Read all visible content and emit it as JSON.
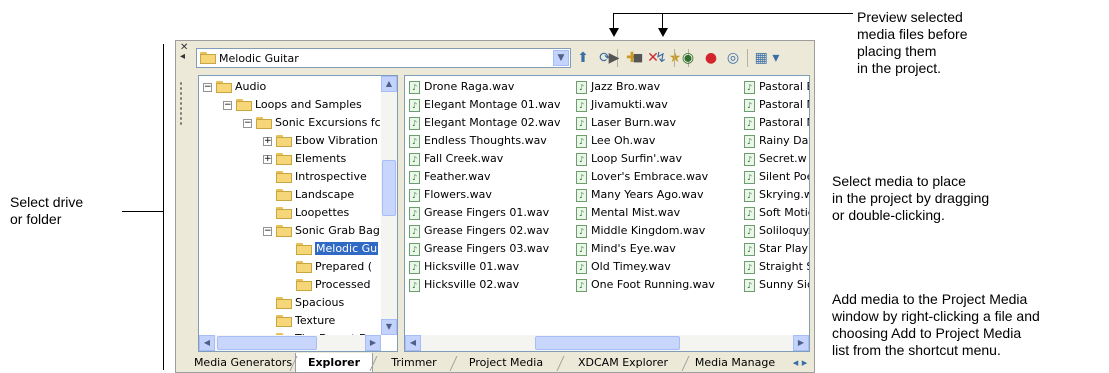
{
  "callouts": {
    "preview_lines": [
      "Preview selected",
      "media files before",
      "placing them",
      "in the project."
    ],
    "select_drive": [
      "Select drive",
      "or folder"
    ],
    "select_media": [
      "Select media to place",
      "in the project by dragging",
      "or double-clicking."
    ],
    "add_media": [
      "Add media to the Project Media",
      "window by right-clicking a file and",
      "choosing Add to Project Media",
      "list from the shortcut menu."
    ]
  },
  "toolbar": {
    "path": "Melodic Guitar",
    "icons": [
      "up-folder-icon",
      "refresh-icon",
      "new-folder-icon",
      "delete-icon",
      "favorites-icon",
      "play-icon",
      "stop-icon",
      "auto-preview-icon",
      "start-icon",
      "web-icon",
      "get-media-icon",
      "views-icon"
    ]
  },
  "tree": [
    {
      "label": "Audio",
      "indent": 0,
      "toggle": "−"
    },
    {
      "label": "Loops and Samples",
      "indent": 1,
      "toggle": "−"
    },
    {
      "label": "Sonic Excursions fc",
      "indent": 2,
      "toggle": "−"
    },
    {
      "label": "Ebow Vibration",
      "indent": 3,
      "toggle": "+"
    },
    {
      "label": "Elements",
      "indent": 3,
      "toggle": "+"
    },
    {
      "label": "Introspective",
      "indent": 3,
      "toggle": ""
    },
    {
      "label": "Landscape",
      "indent": 3,
      "toggle": ""
    },
    {
      "label": "Loopettes",
      "indent": 3,
      "toggle": ""
    },
    {
      "label": "Sonic Grab Bag",
      "indent": 3,
      "toggle": "−"
    },
    {
      "label": "Melodic Gu",
      "indent": 4,
      "toggle": "",
      "selected": true
    },
    {
      "label": "Prepared (",
      "indent": 4,
      "toggle": ""
    },
    {
      "label": "Processed",
      "indent": 4,
      "toggle": ""
    },
    {
      "label": "Spacious",
      "indent": 3,
      "toggle": ""
    },
    {
      "label": "Texture",
      "indent": 3,
      "toggle": ""
    },
    {
      "label": "The Desert Dw",
      "indent": 3,
      "toggle": ""
    }
  ],
  "files": {
    "col1": [
      "Drone Raga.wav",
      "Elegant Montage 01.wav",
      "Elegant Montage 02.wav",
      "Endless Thoughts.wav",
      "Fall Creek.wav",
      "Feather.wav",
      "Flowers.wav",
      "Grease Fingers 01.wav",
      "Grease Fingers 02.wav",
      "Grease Fingers 03.wav",
      "Hicksville 01.wav",
      "Hicksville 02.wav"
    ],
    "col2": [
      "Jazz Bro.wav",
      "Jivamukti.wav",
      "Laser Burn.wav",
      "Lee Oh.wav",
      "Loop Surfin'.wav",
      "Lover's Embrace.wav",
      "Many Years Ago.wav",
      "Mental Mist.wav",
      "Middle Kingdom.wav",
      "Mind's Eye.wav",
      "Old Timey.wav",
      "One Foot Running.wav"
    ],
    "col3": [
      "Pastoral E",
      "Pastoral N",
      "Pastoral N",
      "Rainy Day",
      "Secret.w",
      "Silent Poe",
      "Skrying.w",
      "Soft Motic",
      "Soliloquy.",
      "Star Play",
      "Straight S",
      "Sunny Sic"
    ]
  },
  "tabs": [
    "Media Generators",
    "Explorer",
    "Trimmer",
    "Project Media",
    "XDCAM Explorer",
    "Media Manage"
  ],
  "active_tab": "Explorer"
}
